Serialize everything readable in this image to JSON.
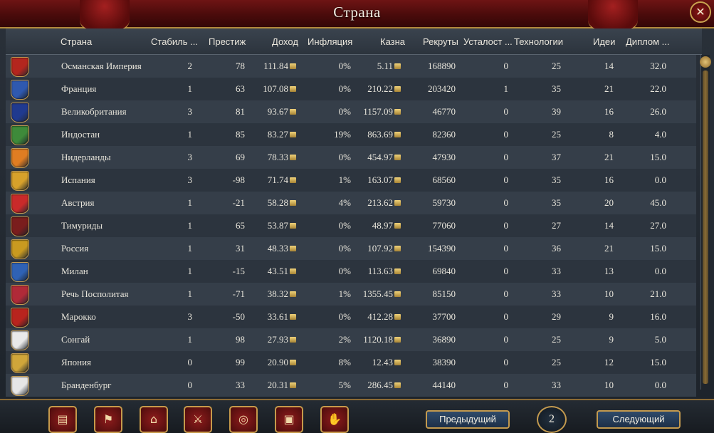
{
  "title": "Страна",
  "close_icon": "close-icon",
  "columns": {
    "country": "Страна",
    "stability": "Стабиль ...",
    "prestige": "Престиж",
    "income": "Доход",
    "inflation": "Инфляция",
    "treasury": "Казна",
    "manpower": "Рекруты",
    "war_exhaustion": "Усталост ...",
    "tech": "Технологии",
    "ideas": "Идеи",
    "diplomacy": "Диплом ..."
  },
  "rows": [
    {
      "flag": "#b3261e",
      "country": "Османская Империя",
      "stability": "2",
      "prestige": "78",
      "income": "111.84",
      "inflation": "0%",
      "treasury": "5.11",
      "manpower": "168890",
      "war_exhaustion": "0",
      "tech": "25",
      "ideas": "14",
      "diplomacy": "32.0"
    },
    {
      "flag": "#2f59b0",
      "country": "Франция",
      "stability": "1",
      "prestige": "63",
      "income": "107.08",
      "inflation": "0%",
      "treasury": "210.22",
      "manpower": "203420",
      "war_exhaustion": "1",
      "tech": "35",
      "ideas": "21",
      "diplomacy": "22.0"
    },
    {
      "flag": "#203a8f",
      "country": "Великобритания",
      "stability": "3",
      "prestige": "81",
      "income": "93.67",
      "inflation": "0%",
      "treasury": "1157.09",
      "manpower": "46770",
      "war_exhaustion": "0",
      "tech": "39",
      "ideas": "16",
      "diplomacy": "26.0"
    },
    {
      "flag": "#3e8a3a",
      "country": "Индостан",
      "stability": "1",
      "prestige": "85",
      "income": "83.27",
      "inflation": "19%",
      "treasury": "863.69",
      "manpower": "82360",
      "war_exhaustion": "0",
      "tech": "25",
      "ideas": "8",
      "diplomacy": "4.0"
    },
    {
      "flag": "#e07d22",
      "country": "Нидерланды",
      "stability": "3",
      "prestige": "69",
      "income": "78.33",
      "inflation": "0%",
      "treasury": "454.97",
      "manpower": "47930",
      "war_exhaustion": "0",
      "tech": "37",
      "ideas": "21",
      "diplomacy": "15.0"
    },
    {
      "flag": "#d7a12b",
      "country": "Испания",
      "stability": "3",
      "prestige": "-98",
      "income": "71.74",
      "inflation": "1%",
      "treasury": "163.07",
      "manpower": "68560",
      "war_exhaustion": "0",
      "tech": "35",
      "ideas": "16",
      "diplomacy": "0.0"
    },
    {
      "flag": "#c92a2a",
      "country": "Австрия",
      "stability": "1",
      "prestige": "-21",
      "income": "58.28",
      "inflation": "4%",
      "treasury": "213.62",
      "manpower": "59730",
      "war_exhaustion": "0",
      "tech": "35",
      "ideas": "20",
      "diplomacy": "45.0"
    },
    {
      "flag": "#7a1d1d",
      "country": "Тимуриды",
      "stability": "1",
      "prestige": "65",
      "income": "53.87",
      "inflation": "0%",
      "treasury": "48.97",
      "manpower": "77060",
      "war_exhaustion": "0",
      "tech": "27",
      "ideas": "14",
      "diplomacy": "27.0"
    },
    {
      "flag": "#c99a20",
      "country": "Россия",
      "stability": "1",
      "prestige": "31",
      "income": "48.33",
      "inflation": "0%",
      "treasury": "107.92",
      "manpower": "154390",
      "war_exhaustion": "0",
      "tech": "36",
      "ideas": "21",
      "diplomacy": "15.0"
    },
    {
      "flag": "#2f62b5",
      "country": "Милан",
      "stability": "1",
      "prestige": "-15",
      "income": "43.51",
      "inflation": "0%",
      "treasury": "113.63",
      "manpower": "69840",
      "war_exhaustion": "0",
      "tech": "33",
      "ideas": "13",
      "diplomacy": "0.0"
    },
    {
      "flag": "#b02a38",
      "country": "Речь Посполитая",
      "stability": "1",
      "prestige": "-71",
      "income": "38.32",
      "inflation": "1%",
      "treasury": "1355.45",
      "manpower": "85150",
      "war_exhaustion": "0",
      "tech": "33",
      "ideas": "10",
      "diplomacy": "21.0"
    },
    {
      "flag": "#b8241e",
      "country": "Марокко",
      "stability": "3",
      "prestige": "-50",
      "income": "33.61",
      "inflation": "0%",
      "treasury": "412.28",
      "manpower": "37700",
      "war_exhaustion": "0",
      "tech": "29",
      "ideas": "9",
      "diplomacy": "16.0"
    },
    {
      "flag": "#e9e9e9",
      "country": "Сонгай",
      "stability": "1",
      "prestige": "98",
      "income": "27.93",
      "inflation": "2%",
      "treasury": "1120.18",
      "manpower": "36890",
      "war_exhaustion": "0",
      "tech": "25",
      "ideas": "9",
      "diplomacy": "5.0"
    },
    {
      "flag": "#d0a63a",
      "country": "Япония",
      "stability": "0",
      "prestige": "99",
      "income": "20.90",
      "inflation": "8%",
      "treasury": "12.43",
      "manpower": "38390",
      "war_exhaustion": "0",
      "tech": "25",
      "ideas": "12",
      "diplomacy": "15.0"
    },
    {
      "flag": "#e6e6e6",
      "country": "Бранденбург",
      "stability": "0",
      "prestige": "33",
      "income": "20.31",
      "inflation": "5%",
      "treasury": "286.45",
      "manpower": "44140",
      "war_exhaustion": "0",
      "tech": "33",
      "ideas": "10",
      "diplomacy": "0.0"
    }
  ],
  "bottom_icons": [
    {
      "name": "ledger-book-icon",
      "glyph": "▤"
    },
    {
      "name": "flag-icon",
      "glyph": "⚑"
    },
    {
      "name": "buildings-icon",
      "glyph": "⌂"
    },
    {
      "name": "crossed-swords-icon",
      "glyph": "⚔"
    },
    {
      "name": "coins-icon",
      "glyph": "◎"
    },
    {
      "name": "trade-crate-icon",
      "glyph": "▣"
    },
    {
      "name": "handshake-icon",
      "glyph": "✋"
    }
  ],
  "pagination": {
    "prev_label": "Предыдущий",
    "page": "2",
    "next_label": "Следующий"
  }
}
